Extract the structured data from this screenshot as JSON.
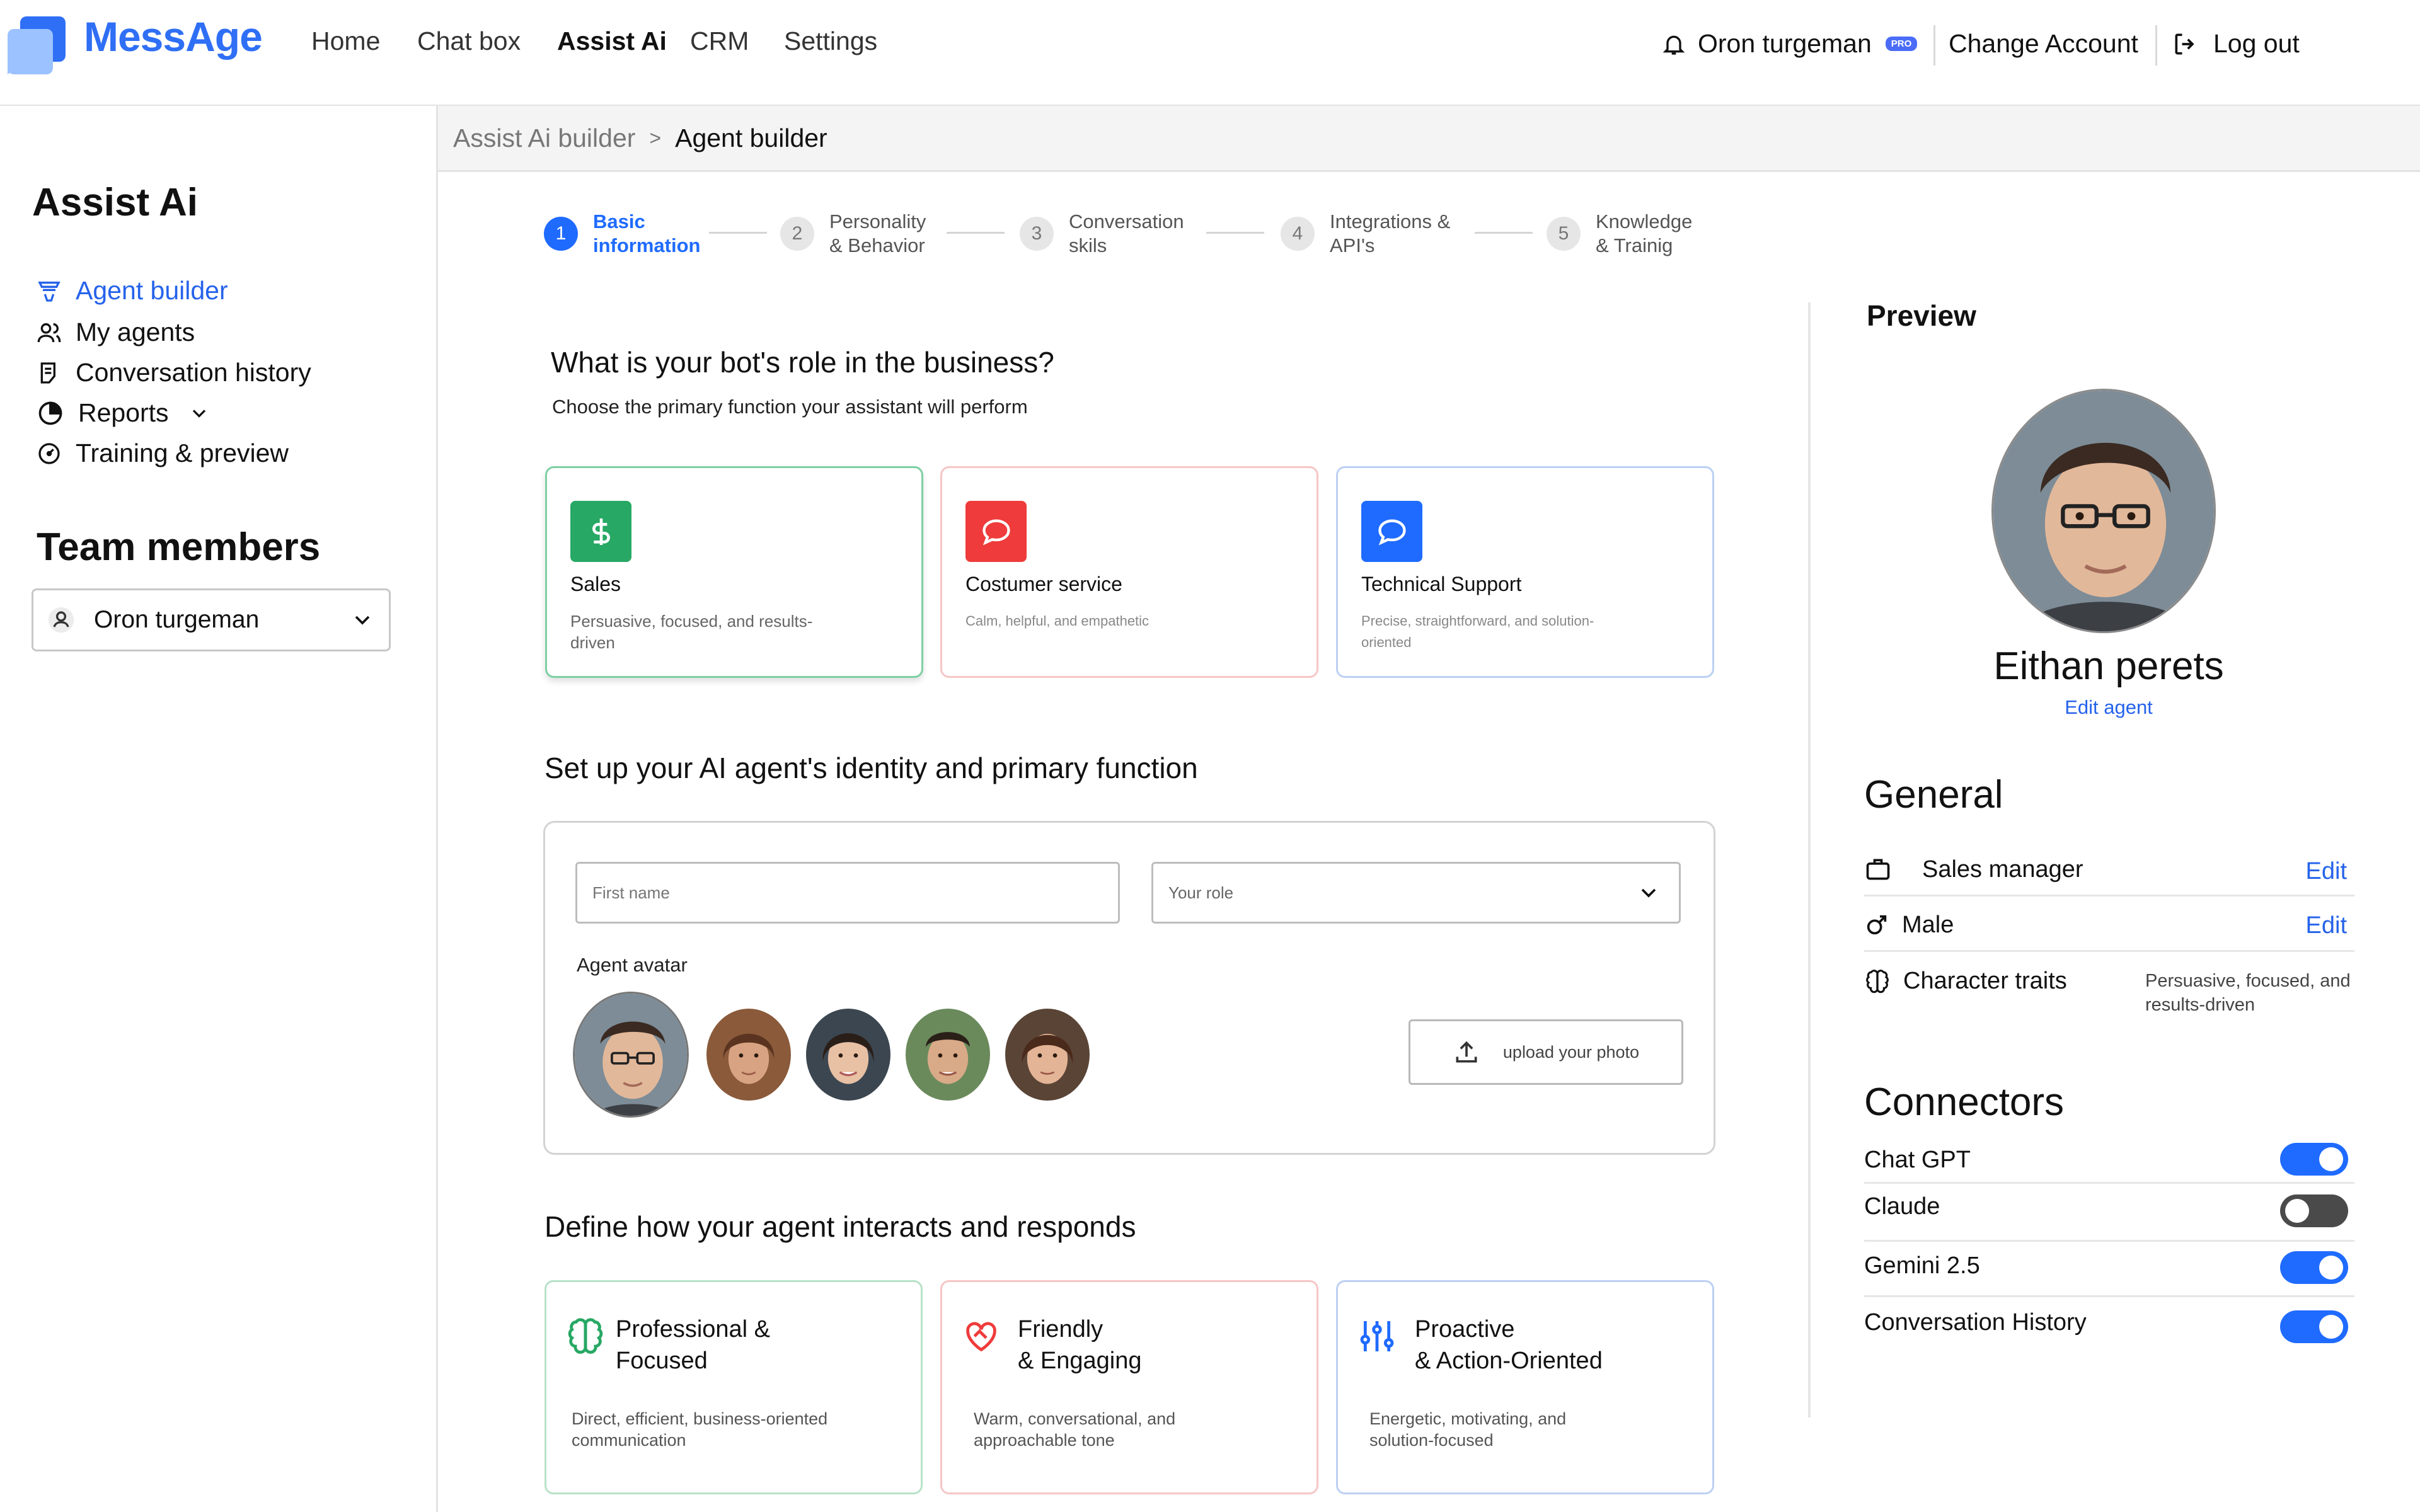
{
  "app": {
    "name": "MessAge"
  },
  "nav": {
    "items": [
      {
        "label": "Home"
      },
      {
        "label": "Chat box"
      },
      {
        "label": "Assist Ai"
      },
      {
        "label": "CRM"
      },
      {
        "label": "Settings"
      }
    ],
    "active": "Assist Ai",
    "user_name": "Oron turgeman",
    "pro_badge": "PRO",
    "change_account": "Change Account",
    "logout": "Log out"
  },
  "sidebar": {
    "title": "Assist Ai",
    "items": [
      {
        "label": "Agent builder",
        "icon": "filter-icon",
        "active": true
      },
      {
        "label": "My agents",
        "icon": "users-icon"
      },
      {
        "label": "Conversation history",
        "icon": "document-list-icon"
      },
      {
        "label": "Reports",
        "icon": "pie-chart-icon",
        "has_dropdown": true
      },
      {
        "label": "Training & preview",
        "icon": "gauge-icon"
      }
    ],
    "team_title": "Team members",
    "team_selected": "Oron turgeman"
  },
  "breadcrumb": {
    "parent": "Assist Ai builder",
    "separator": ">",
    "current": "Agent builder"
  },
  "stepper": {
    "steps": [
      {
        "num": "1",
        "line1": "Basic",
        "line2": "information",
        "active": true
      },
      {
        "num": "2",
        "line1": "Personality",
        "line2": "& Behavior"
      },
      {
        "num": "3",
        "line1": "Conversation",
        "line2": "skils"
      },
      {
        "num": "4",
        "line1": "Integrations &",
        "line2": "API's"
      },
      {
        "num": "5",
        "line1": "Knowledge",
        "line2": "& Trainig"
      }
    ]
  },
  "role_section": {
    "title": "What is your bot's role in the business?",
    "subtitle": "Choose the primary function your assistant will perform",
    "cards": [
      {
        "title": "Sales",
        "desc": "Persuasive, focused, and results-driven",
        "color": "#27a864",
        "icon": "dollar-icon"
      },
      {
        "title": "Costumer service",
        "desc": "Calm, helpful, and empathetic",
        "color": "#ef3b3b",
        "icon": "chat-bubble-icon"
      },
      {
        "title": "Technical Support",
        "desc": "Precise, straightforward, and solution-oriented",
        "color": "#1f6bff",
        "icon": "chat-bubble-icon"
      }
    ]
  },
  "identity_section": {
    "title": "Set up your AI agent's identity and primary function",
    "first_name_placeholder": "First name",
    "role_placeholder": "Your role",
    "avatar_label": "Agent avatar",
    "upload_label": "upload your photo"
  },
  "tone_section": {
    "title": "Define how your agent interacts and responds",
    "cards": [
      {
        "title_line1": "Professional &",
        "title_line2": "Focused",
        "desc": "Direct, efficient, business-oriented communication",
        "color": "#27a864",
        "icon": "brain-icon"
      },
      {
        "title_line1": "Friendly",
        "title_line2": "& Engaging",
        "desc": "Warm, conversational, and approachable tone",
        "color": "#ef3b3b",
        "icon": "heart-handshake-icon"
      },
      {
        "title_line1": "Proactive",
        "title_line2": "& Action-Oriented",
        "desc": "Energetic, motivating, and solution-focused",
        "color": "#1f6bff",
        "icon": "sliders-icon"
      }
    ]
  },
  "preview": {
    "title": "Preview",
    "agent_name": "Eithan perets",
    "edit_agent": "Edit agent",
    "general_title": "General",
    "role_value": "Sales manager",
    "gender_value": "Male",
    "traits_label": "Character traits",
    "traits_value": "Persuasive, focused, and results-driven",
    "edit_label": "Edit",
    "connectors_title": "Connectors",
    "connectors": [
      {
        "name": "Chat GPT",
        "enabled": true
      },
      {
        "name": "Claude",
        "enabled": false
      },
      {
        "name": "Gemini 2.5",
        "enabled": true
      },
      {
        "name": "Conversation History",
        "enabled": true
      }
    ]
  },
  "colors": {
    "accent": "#1f6bff",
    "link": "#2563eb",
    "success": "#27a864",
    "danger": "#ef3b3b"
  }
}
